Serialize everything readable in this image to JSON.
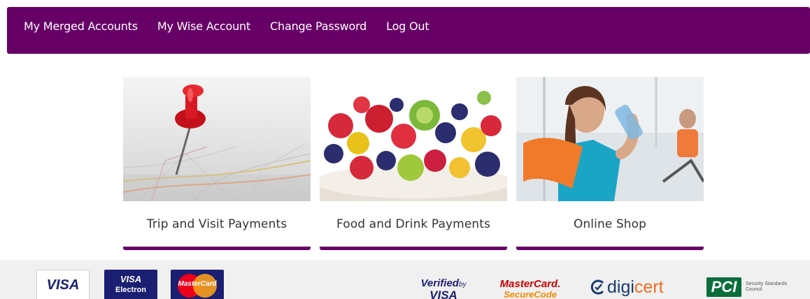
{
  "nav": {
    "items": [
      {
        "label": "My Merged Accounts"
      },
      {
        "label": "My Wise Account"
      },
      {
        "label": "Change Password"
      },
      {
        "label": "Log Out"
      }
    ]
  },
  "tiles": [
    {
      "label": "Trip and Visit Payments",
      "icon": "map-pin-image"
    },
    {
      "label": "Food and Drink Payments",
      "icon": "fruit-bowl-image"
    },
    {
      "label": "Online Shop",
      "icon": "gym-woman-image"
    }
  ],
  "footer": {
    "visa": "VISA",
    "visa_electron_1": "VISA",
    "visa_electron_2": "Electron",
    "mastercard": "MasterCard",
    "vbv_1": "Verified",
    "vbv_by": "by",
    "vbv_2": "VISA",
    "mcsc_1": "MasterCard.",
    "mcsc_2": "SecureCode",
    "digicert_1": "digi",
    "digicert_2": "cert",
    "pci_mark": "PCI",
    "pci_sub": "Security Standards Council"
  },
  "colors": {
    "brand": "#660066",
    "text": "#333333",
    "footer_bg": "#f0f0f0"
  }
}
